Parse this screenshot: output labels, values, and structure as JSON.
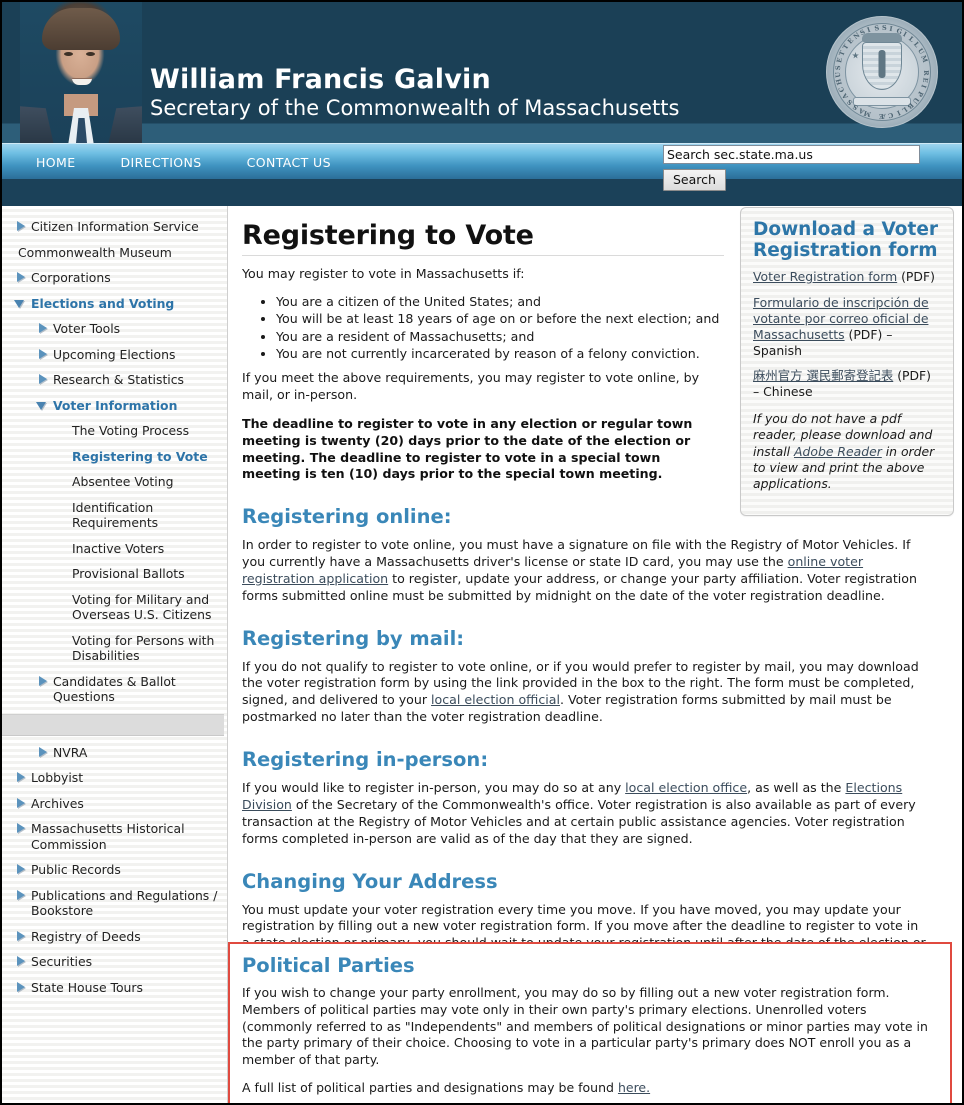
{
  "header": {
    "name": "William Francis Galvin",
    "subtitle": "Secretary of the Commonwealth of Massachusetts",
    "seal_rim_text": "SIGILLUM REIPUBLICÆ MASSACHUSETTENSIS",
    "bg_color": "#1b4056"
  },
  "nav": {
    "links": [
      {
        "label": "HOME"
      },
      {
        "label": "DIRECTIONS"
      },
      {
        "label": "CONTACT US"
      }
    ],
    "search_value": "Search sec.state.ma.us",
    "search_placeholder": "Search sec.state.ma.us",
    "search_button": "Search"
  },
  "sidebar": {
    "items": [
      {
        "label": "Citizen Information Service",
        "level": 0,
        "icon": "triangle-right",
        "state": "collapsed"
      },
      {
        "label": "Commonwealth Museum",
        "level": 0,
        "icon": "none",
        "state": "leaf"
      },
      {
        "label": "Corporations",
        "level": 0,
        "icon": "triangle-right",
        "state": "collapsed"
      },
      {
        "label": "Elections and Voting",
        "level": 0,
        "icon": "triangle-down",
        "state": "expanded",
        "emphasis": "bold"
      },
      {
        "label": "Voter Tools",
        "level": 1,
        "icon": "triangle-right",
        "state": "collapsed"
      },
      {
        "label": "Upcoming Elections",
        "level": 1,
        "icon": "triangle-right",
        "state": "collapsed"
      },
      {
        "label": "Research & Statistics",
        "level": 1,
        "icon": "triangle-right",
        "state": "collapsed"
      },
      {
        "label": "Voter Information",
        "level": 1,
        "icon": "triangle-down",
        "state": "expanded",
        "emphasis": "bold"
      },
      {
        "label": "The Voting Process",
        "level": 2,
        "icon": "none",
        "state": "leaf"
      },
      {
        "label": "Registering to Vote",
        "level": 2,
        "icon": "none",
        "state": "current",
        "emphasis": "current"
      },
      {
        "label": "Absentee Voting",
        "level": 2,
        "icon": "none",
        "state": "leaf"
      },
      {
        "label": "Identification Requirements",
        "level": 2,
        "icon": "none",
        "state": "leaf"
      },
      {
        "label": "Inactive Voters",
        "level": 2,
        "icon": "none",
        "state": "leaf"
      },
      {
        "label": "Provisional Ballots",
        "level": 2,
        "icon": "none",
        "state": "leaf"
      },
      {
        "label": "Voting for Military and Overseas U.S. Citizens",
        "level": 2,
        "icon": "none",
        "state": "leaf"
      },
      {
        "label": "Voting for Persons with Disabilities",
        "level": 2,
        "icon": "none",
        "state": "leaf"
      },
      {
        "label": "Candidates & Ballot Questions",
        "level": 1,
        "icon": "triangle-right",
        "state": "collapsed"
      },
      {
        "label": "",
        "level": 1,
        "icon": "none",
        "state": "spacer"
      },
      {
        "label": "NVRA",
        "level": 1,
        "icon": "triangle-right",
        "state": "collapsed"
      },
      {
        "label": "Lobbyist",
        "level": 0,
        "icon": "triangle-right",
        "state": "collapsed"
      },
      {
        "label": "Archives",
        "level": 0,
        "icon": "triangle-right",
        "state": "collapsed"
      },
      {
        "label": "Massachusetts Historical Commission",
        "level": 0,
        "icon": "triangle-right",
        "state": "collapsed"
      },
      {
        "label": "Public Records",
        "level": 0,
        "icon": "triangle-right",
        "state": "collapsed"
      },
      {
        "label": "Publications and Regulations / Bookstore",
        "level": 0,
        "icon": "triangle-right",
        "state": "collapsed"
      },
      {
        "label": "Registry of Deeds",
        "level": 0,
        "icon": "triangle-right",
        "state": "collapsed"
      },
      {
        "label": "Securities",
        "level": 0,
        "icon": "triangle-right",
        "state": "collapsed"
      },
      {
        "label": "State House Tours",
        "level": 0,
        "icon": "triangle-right",
        "state": "collapsed"
      }
    ]
  },
  "main": {
    "title": "Registering to Vote",
    "intro": "You may register to vote in Massachusetts if:",
    "requirements": [
      "You are a citizen of the United States; and",
      "You will be at least 18 years of age on or before the next election; and",
      "You are a resident of Massachusetts; and",
      "You are not currently incarcerated by reason of a felony conviction."
    ],
    "after_list": "If you meet the above requirements, you may register to vote online, by mail, or in-person.",
    "deadline": "The deadline to register to vote in any election or regular town meeting is twenty (20) days prior to the date of the election or meeting. The deadline to register to vote in a special town meeting is ten (10) days prior to the special town meeting.",
    "sections": [
      {
        "heading": "Registering online:",
        "text_1": "In order to register to vote online, you must have a signature on file with the Registry of Motor Vehicles. If you currently have a Massachusetts driver's license or state ID card, you may use the ",
        "link": "online voter registration application",
        "text_2": " to register, update your address, or change your party affiliation. Voter registration forms submitted online must be submitted by midnight on the date of the voter registration deadline."
      },
      {
        "heading": "Registering by mail:",
        "text_1": "If you do not qualify to register to vote online, or if you would prefer to register by mail, you may download the voter registration form by using the link provided in the box to the right. The form must be completed, signed, and delivered to your ",
        "link": "local election official",
        "text_2": ". Voter registration forms submitted by mail must be postmarked no later than the voter registration deadline."
      },
      {
        "heading": "Registering in-person:",
        "text_1": "If you would like to register in-person, you may do so at any ",
        "link": "local election office",
        "text_2": ", as well as the ",
        "link2": "Elections Division",
        "text_3": " of the Secretary of the Commonwealth's office. Voter registration is also available as part of every transaction at the Registry of Motor Vehicles and at certain public assistance agencies. Voter registration forms completed in-person are valid as of the day that they are signed."
      },
      {
        "heading": "Changing Your Address",
        "text_1": "You must update your voter registration every time you move. If you have moved, you may update your registration by filling out a new voter registration form. If you move after the deadline to register to vote in a state election or primary, you should wait to update your registration until after the date of the election or primary, and return to vote at your previous polling place in Massachusetts. State law allows you to vote from a previous address in a state election for up to six month after you have moved, as long as you have not registered elsewhere."
      }
    ],
    "political_parties": {
      "heading": "Political Parties",
      "paragraph_1": "If you wish to change your party enrollment, you may do so by filling out a new voter registration form. Members of political parties may vote only in their own party's primary elections. Unenrolled voters (commonly referred to as \"Independents\" and members of political designations or minor parties may vote in the party primary of their choice. Choosing to vote in a particular party's primary does NOT enroll you as a member of that party.",
      "paragraph_2_before": "A full list of political parties and designations may be found ",
      "paragraph_2_link": "here.",
      "border_color": "#e04a3f"
    }
  },
  "sidebox": {
    "heading": "Download a Voter Registration form",
    "items": [
      {
        "link": "Voter Registration form",
        "after": " (PDF)"
      },
      {
        "link": "Formulario de inscripción de votante por correo oficial de Massachusetts",
        "after": " (PDF) – Spanish"
      },
      {
        "link": "麻州官方 選民郵寄登記表",
        "after": " (PDF) – Chinese"
      }
    ],
    "note_before": "If you do not have a pdf reader, please download and install ",
    "note_link": "Adobe Reader",
    "note_after": " in order to view and print the above applications."
  },
  "colors": {
    "header_blue": "#1b4056",
    "accent_heading": "#3a87b8",
    "nav_link_blue": "#2d74a8",
    "alert_red": "#e04a3f"
  }
}
